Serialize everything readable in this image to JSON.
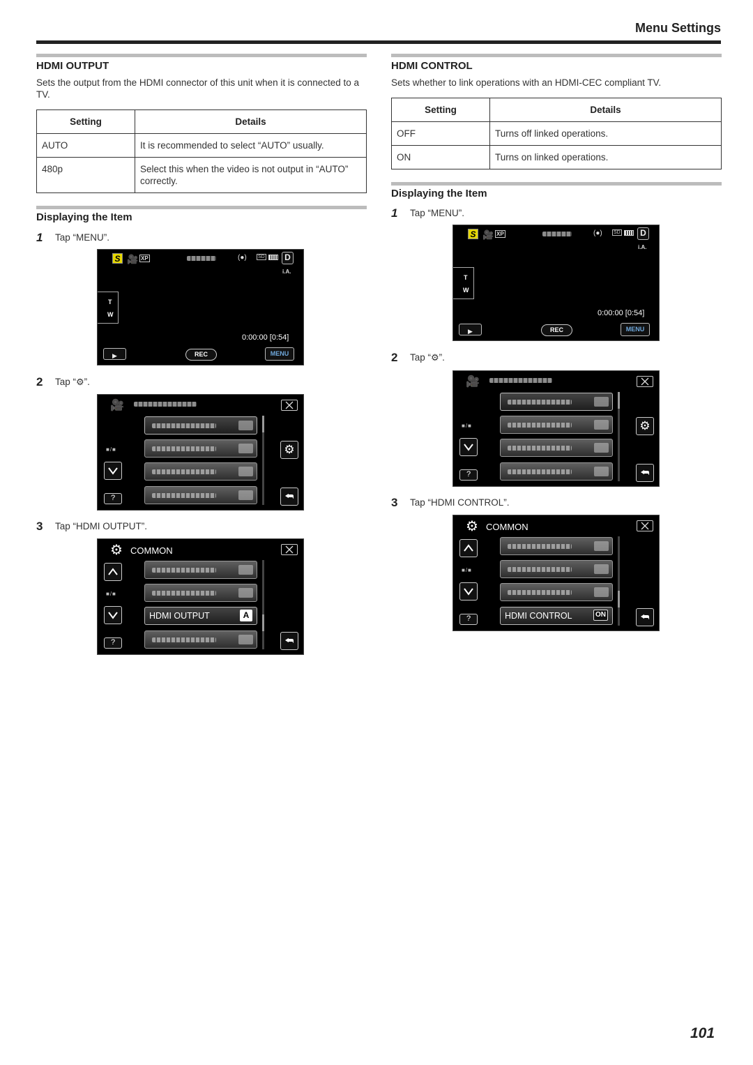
{
  "header": {
    "section_title": "Menu Settings"
  },
  "left": {
    "title": "HDMI OUTPUT",
    "description": "Sets the output from the HDMI connector of this unit when it is connected to a TV.",
    "table": {
      "headers": [
        "Setting",
        "Details"
      ],
      "rows": [
        [
          "AUTO",
          "It is recommended to select “AUTO” usually."
        ],
        [
          "480p",
          "Select this when the video is not output in “AUTO” correctly."
        ]
      ]
    },
    "sub_title": "Displaying the Item",
    "steps": [
      {
        "num": "1",
        "text": "Tap “MENU”."
      },
      {
        "num": "2",
        "text_before": "Tap “",
        "icon": "gear-icon",
        "text_after": "”."
      },
      {
        "num": "3",
        "text": "Tap “HDMI OUTPUT”."
      }
    ],
    "screen3": {
      "header_label": "COMMON",
      "highlighted_item": "HDMI OUTPUT",
      "highlighted_value": "A"
    }
  },
  "right": {
    "title": "HDMI CONTROL",
    "description": "Sets whether to link operations with an HDMI-CEC compliant TV.",
    "table": {
      "headers": [
        "Setting",
        "Details"
      ],
      "rows": [
        [
          "OFF",
          "Turns off linked operations."
        ],
        [
          "ON",
          "Turns on linked operations."
        ]
      ]
    },
    "sub_title": "Displaying the Item",
    "steps": [
      {
        "num": "1",
        "text": "Tap “MENU”."
      },
      {
        "num": "2",
        "text_before": "Tap “",
        "icon": "gear-icon",
        "text_after": "”."
      },
      {
        "num": "3",
        "text": "Tap “HDMI CONTROL”."
      }
    ],
    "screen3": {
      "header_label": "COMMON",
      "highlighted_item": "HDMI CONTROL",
      "highlighted_value": "ON"
    }
  },
  "camera_screen": {
    "mode_icon": "S",
    "quality": "XP",
    "media": "SD",
    "recording_mode": "D",
    "scene": "i.A.",
    "zoom_t": "T",
    "zoom_w": "W",
    "time": "0:00:00",
    "remaining": "[0:54]",
    "rec_label": "REC",
    "menu_label": "MENU",
    "help_label": "?"
  },
  "colors": {
    "mode_icon": "#e6d800",
    "menu_text": "#6fa8dc"
  },
  "page_number": "101"
}
